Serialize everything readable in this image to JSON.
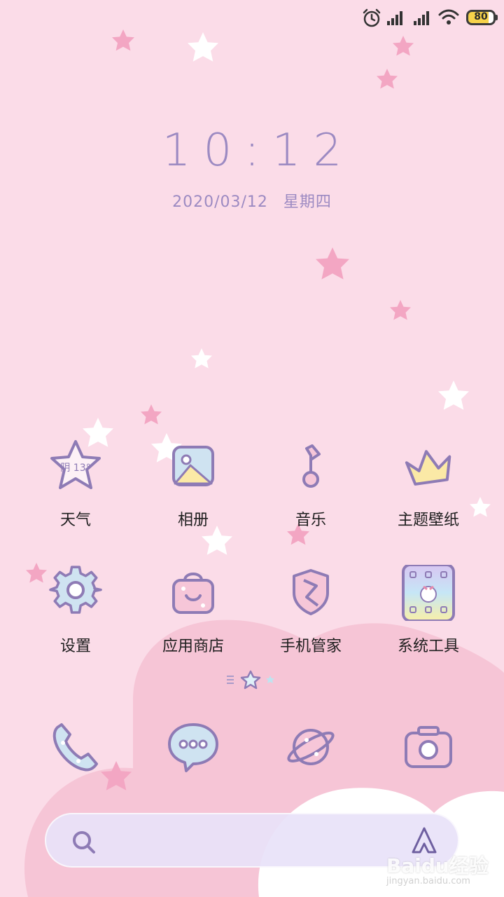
{
  "status_bar": {
    "battery_level": "80",
    "icons": [
      "alarm-icon",
      "signal-icon",
      "signal-icon",
      "wifi-icon",
      "battery-icon"
    ]
  },
  "lockscreen": {
    "time": "10:12",
    "date": "2020/03/12",
    "weekday": "星期四"
  },
  "apps": [
    {
      "label": "天气",
      "icon": "weather-star-icon",
      "badge": "阴 13°"
    },
    {
      "label": "相册",
      "icon": "gallery-icon"
    },
    {
      "label": "音乐",
      "icon": "music-note-icon"
    },
    {
      "label": "主题壁纸",
      "icon": "crown-icon"
    },
    {
      "label": "设置",
      "icon": "gear-icon"
    },
    {
      "label": "应用商店",
      "icon": "shopping-bag-icon"
    },
    {
      "label": "手机管家",
      "icon": "shield-icon"
    },
    {
      "label": "系统工具",
      "icon": "tools-folder-icon"
    }
  ],
  "dock": [
    {
      "icon": "phone-icon"
    },
    {
      "icon": "message-bubble-icon"
    },
    {
      "icon": "browser-planet-icon"
    },
    {
      "icon": "camera-icon"
    }
  ],
  "search": {
    "icon": "search-icon",
    "assistant_icon": "a-logo-icon"
  },
  "watermark": {
    "main": "Baidu经验",
    "sub": "jingyan.baidu.com"
  },
  "colors": {
    "background": "#fbdce8",
    "accent": "#9c8ac2",
    "icon_outline": "#8e7bb5",
    "icon_fill_blue": "#cfe3f1",
    "icon_fill_pink": "#f6c6d8",
    "star_pink": "#f3a6c3"
  }
}
